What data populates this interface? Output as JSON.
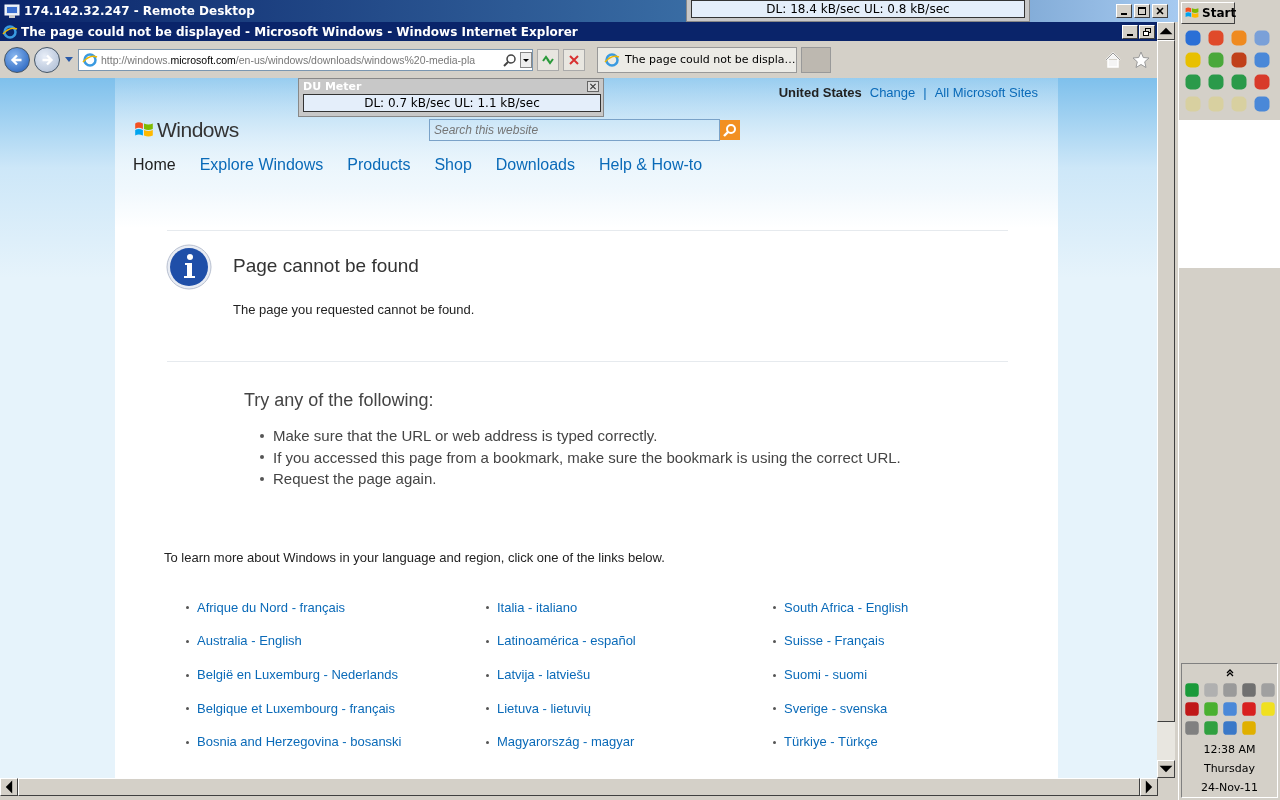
{
  "remote_desktop": {
    "title": "174.142.32.247 - Remote Desktop"
  },
  "du_meter_top": {
    "reading": "DL: 18.4 kB/sec  UL: 0.8 kB/sec"
  },
  "browser": {
    "title": "The page could not be displayed - Microsoft Windows - Windows Internet Explorer",
    "address": "http://windows.**microsoft.com**/en-us/windows/downloads/windows%20-media-pla",
    "tabs": [
      {
        "label": "The page could not be displa…",
        "selected": true
      }
    ]
  },
  "du_meter": {
    "title": "DU Meter",
    "reading": "DL: 0.7 kB/sec  UL: 1.1 kB/sec"
  },
  "page": {
    "locale": "United States",
    "change": "Change",
    "separator": "|",
    "all_sites": "All Microsoft Sites",
    "logo": "Windows",
    "search": {
      "placeholder": "Search this website"
    },
    "nav": [
      {
        "label": "Home",
        "selected": true
      },
      {
        "label": "Explore Windows",
        "selected": false
      },
      {
        "label": "Products",
        "selected": false
      },
      {
        "label": "Shop",
        "selected": false
      },
      {
        "label": "Downloads",
        "selected": false
      },
      {
        "label": "Help & How-to",
        "selected": false
      }
    ],
    "error": {
      "title": "Page cannot be found",
      "message": "The page you requested cannot be found."
    },
    "suggestions": {
      "heading": "Try any of the following:",
      "items": [
        "Make sure that the URL or web address is typed correctly.",
        "If you accessed this page from a bookmark, make sure the bookmark is using the correct URL.",
        "Request the page again."
      ]
    },
    "regions_intro": "To learn more about Windows in your language and region, click one of the links below.",
    "regions": [
      [
        "Afrique du Nord - français",
        "Australia - English",
        "België en Luxemburg - Nederlands",
        "Belgique et Luxembourg - français",
        "Bosnia and Herzegovina - bosanski"
      ],
      [
        "Italia - italiano",
        "Latinoamérica - español",
        "Latvija - latviešu",
        "Lietuva - lietuvių",
        "Magyarország - magyar"
      ],
      [
        "South Africa - English",
        "Suisse - Français",
        "Suomi - suomi",
        "Sverige - svenska",
        "Türkiye - Türkçe"
      ]
    ]
  },
  "taskbar": {
    "start": "Start",
    "clock": {
      "time": "12:38 AM",
      "day": "Thursday",
      "date": "24-Nov-11"
    }
  }
}
